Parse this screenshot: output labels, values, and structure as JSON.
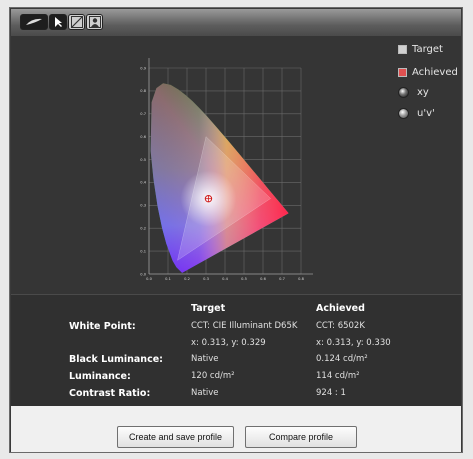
{
  "legend": {
    "target_label": "Target",
    "achieved_label": "Achieved",
    "xy_label": "xy",
    "uv_label": "u'v'",
    "target_color": "#d8d8d8",
    "achieved_color": "#e05050",
    "selected_space": "xy"
  },
  "chart_data": {
    "type": "scatter",
    "xlim": [
      0.0,
      0.8
    ],
    "ylim": [
      0.0,
      0.9
    ],
    "x_ticks": [
      "0.0",
      "0.1",
      "0.2",
      "0.3",
      "0.4",
      "0.5",
      "0.6",
      "0.7",
      "0.8"
    ],
    "y_ticks": [
      "0.0",
      "0.1",
      "0.2",
      "0.3",
      "0.4",
      "0.5",
      "0.6",
      "0.7",
      "0.8",
      "0.9"
    ],
    "grid": true,
    "gamut_triangle": [
      {
        "x": 0.64,
        "y": 0.33
      },
      {
        "x": 0.3,
        "y": 0.6
      },
      {
        "x": 0.15,
        "y": 0.06
      }
    ],
    "white_point": {
      "x": 0.313,
      "y": 0.329
    }
  },
  "stats": {
    "col_target": "Target",
    "col_achieved": "Achieved",
    "white_point_label": "White Point:",
    "white_target_cct": "CCT: CIE Illuminant D65K",
    "white_achieved_cct": "CCT: 6502K",
    "white_target_xy": "x: 0.313, y: 0.329",
    "white_achieved_xy": "x: 0.313, y: 0.330",
    "black_label": "Black Luminance:",
    "black_target": "Native",
    "black_achieved": "0.124 cd/m²",
    "lum_label": "Luminance:",
    "lum_target": "120 cd/m²",
    "lum_achieved": "114 cd/m²",
    "contrast_label": "Contrast Ratio:",
    "contrast_target": "Native",
    "contrast_achieved": "924 : 1"
  },
  "buttons": {
    "create": "Create and save profile",
    "compare": "Compare profile"
  }
}
